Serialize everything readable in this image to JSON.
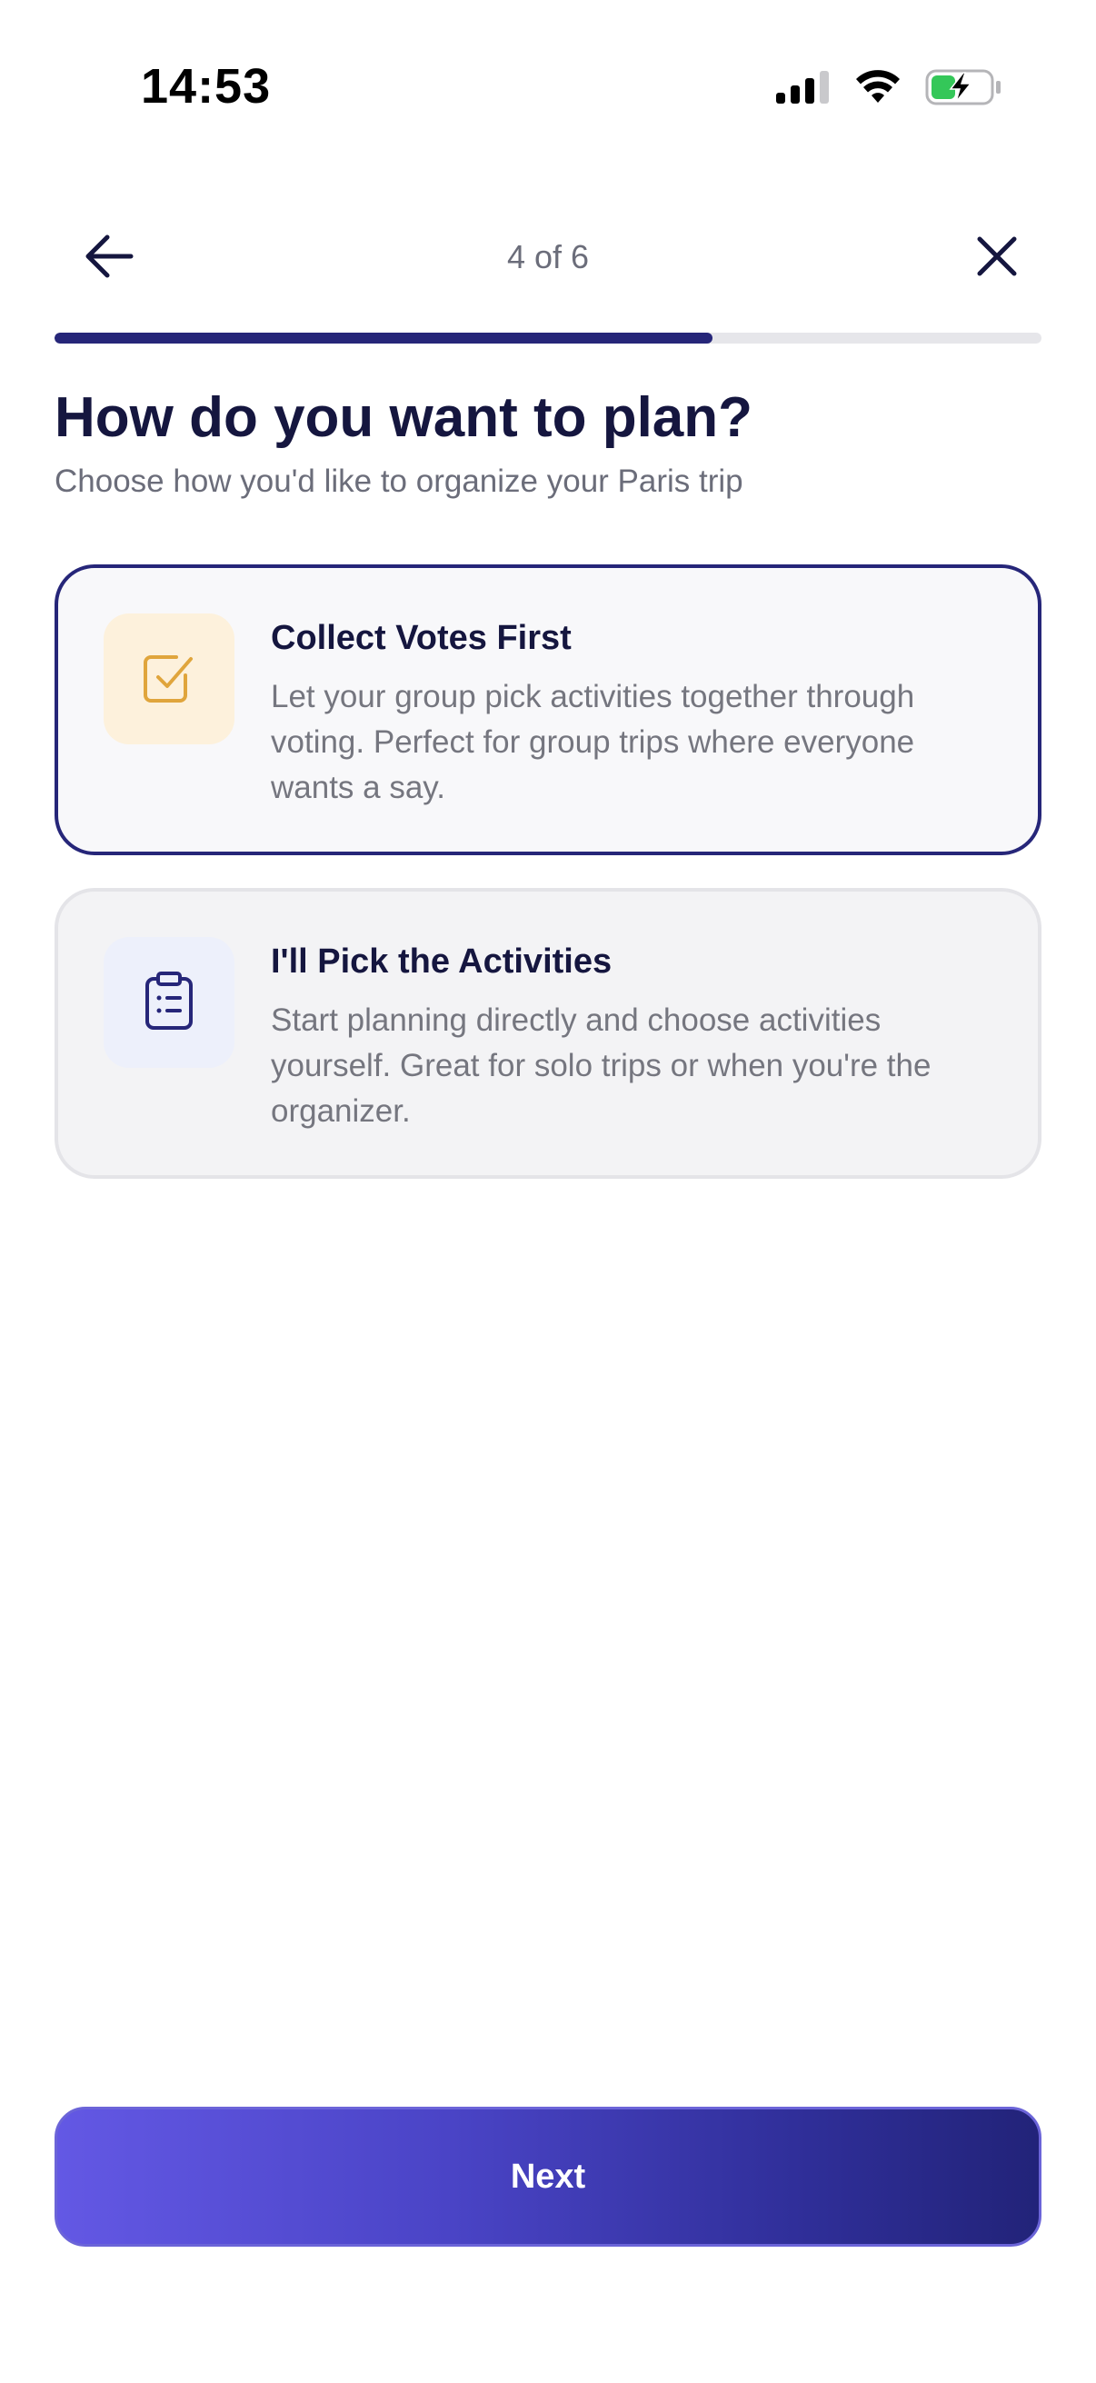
{
  "status_bar": {
    "time": "14:53",
    "icons": [
      "cellular-signal-icon",
      "wifi-icon",
      "battery-charging-icon"
    ]
  },
  "header": {
    "step_indicator": "4 of 6",
    "back_icon": "arrow-left-icon",
    "close_icon": "close-icon"
  },
  "progress": {
    "current_step": 4,
    "total_steps": 6,
    "fraction": 0.6667
  },
  "page": {
    "title": "How do you want to plan?",
    "subtitle": "Choose how you'd like to organize your Paris trip"
  },
  "options": [
    {
      "title": "Collect Votes First",
      "description": "Let your group pick activities together through voting. Perfect for group trips where everyone wants a say.",
      "icon": "checkbox-icon",
      "selected": true
    },
    {
      "title": "I'll Pick the Activities",
      "description": "Start planning directly and choose activities yourself. Great for solo trips or when you're the organizer.",
      "icon": "clipboard-list-icon",
      "selected": false
    }
  ],
  "footer": {
    "next_label": "Next"
  },
  "colors": {
    "primary": "#262679",
    "gradient_start": "#6358e4",
    "gradient_end": "#222379",
    "vote_icon": "#e0a53c",
    "vote_icon_bg": "#fdf1dc",
    "pick_icon_bg": "#edf0fb"
  }
}
